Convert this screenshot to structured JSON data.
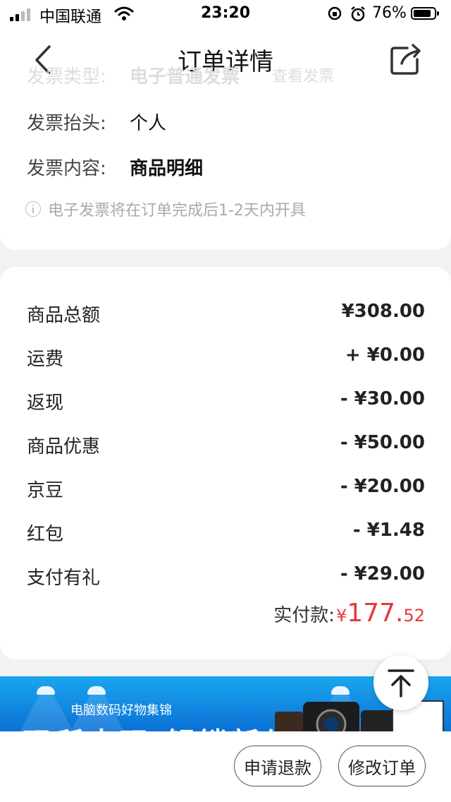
{
  "status_bar": {
    "carrier": "中国联通",
    "time": "23:20",
    "battery": "76%"
  },
  "nav": {
    "title": "订单详情",
    "back_icon": "chevron-left-icon",
    "share_icon": "share-icon"
  },
  "invoice": {
    "type_label": "发票类型:",
    "type_value": "电子普通发票",
    "view_button": "查看发票",
    "header_label": "发票抬头:",
    "header_value": "个人",
    "content_label": "发票内容:",
    "content_value": "商品明细",
    "note": "电子发票将在订单完成后1-2天内开具"
  },
  "price": {
    "rows": [
      {
        "label": "商品总额",
        "amount": "¥308.00"
      },
      {
        "label": "运费",
        "amount": "+ ¥0.00"
      },
      {
        "label": "返现",
        "amount": "- ¥30.00"
      },
      {
        "label": "商品优惠",
        "amount": "- ¥50.00"
      },
      {
        "label": "京豆",
        "amount": "- ¥20.00"
      },
      {
        "label": "红包",
        "amount": "- ¥1.48"
      },
      {
        "label": "支付有礼",
        "amount": "- ¥29.00"
      }
    ],
    "paid_label": "实付款:",
    "paid_currency": "¥",
    "paid_integer": "177.",
    "paid_decimal": "52",
    "accent_color": "#e4393c"
  },
  "banner": {
    "subtitle": "电脑数码好物集锦",
    "headline": "玩所未玩 解锁新生"
  },
  "actions": {
    "refund": "申请退款",
    "modify": "修改订单"
  }
}
